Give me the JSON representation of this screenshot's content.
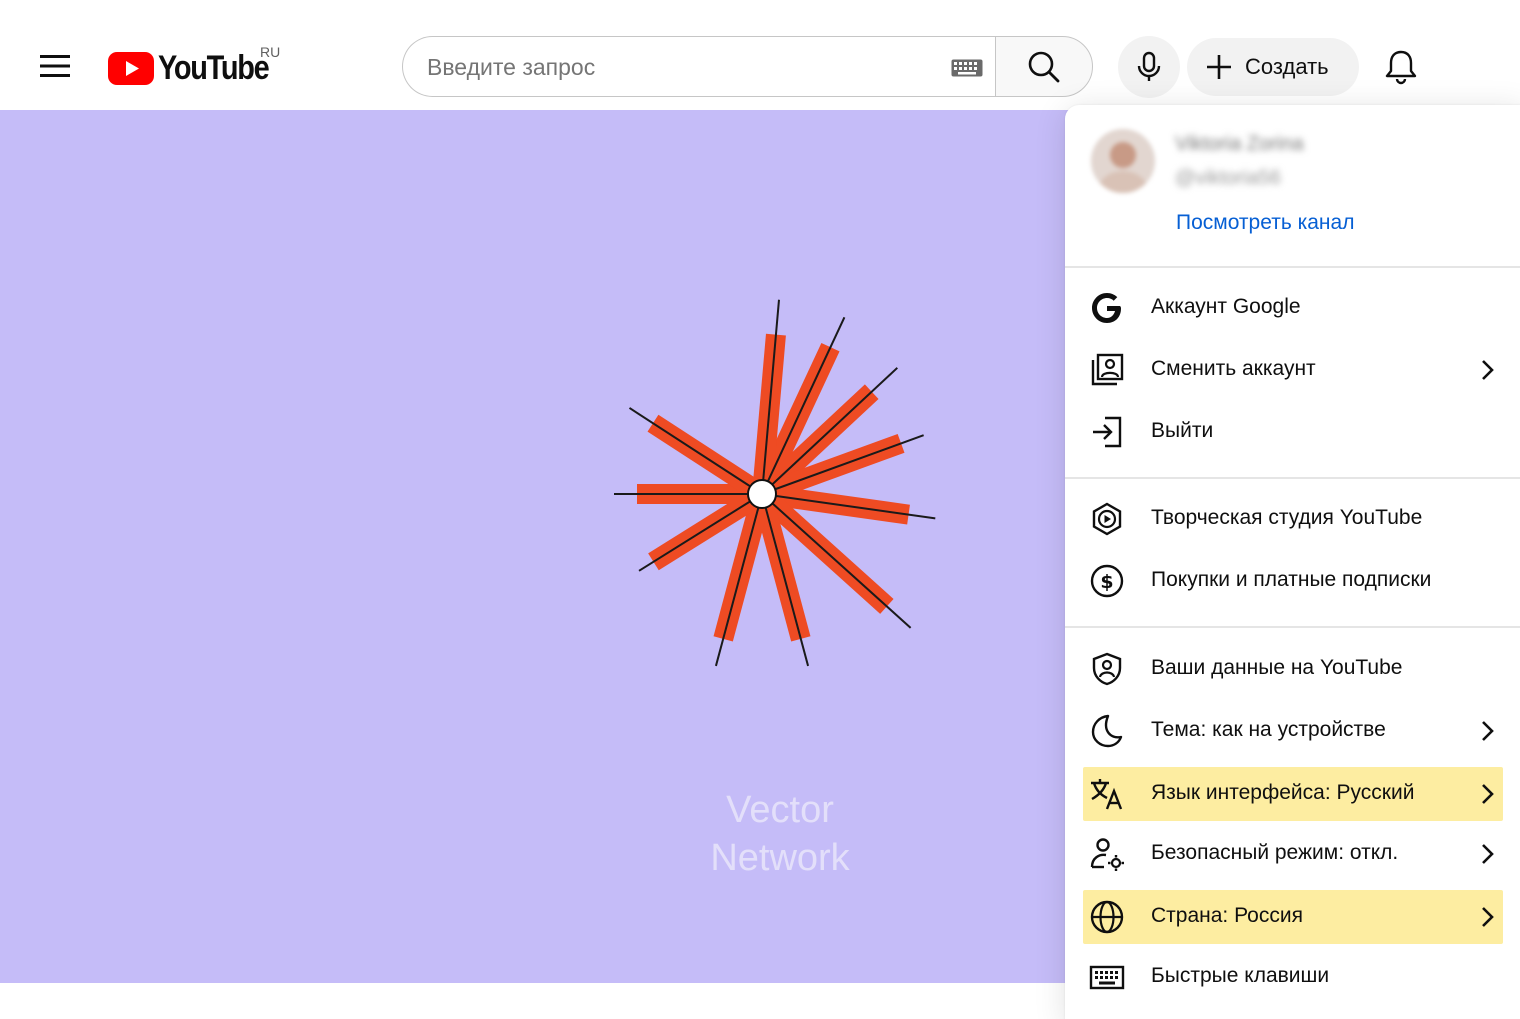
{
  "header": {
    "logo_text": "YouTube",
    "country_code": "RU",
    "search_placeholder": "Введите запрос",
    "create_label": "Создать"
  },
  "video": {
    "watermark_line1": "Vector",
    "watermark_line2": "Network",
    "background_color": "#c5bcf8",
    "accent_color": "#ee4b23"
  },
  "account": {
    "name": "Viktoria Zorina",
    "handle": "@viktoria56",
    "view_channel": "Посмотреть канал"
  },
  "menu": {
    "google_account": "Аккаунт Google",
    "switch_account": "Сменить аккаунт",
    "sign_out": "Выйти",
    "studio": "Творческая студия YouTube",
    "purchases": "Покупки и платные подписки",
    "your_data": "Ваши данные на YouTube",
    "theme": "Тема: как на устройстве",
    "language": "Язык интерфейса: Русский",
    "restricted_mode": "Безопасный режим: откл.",
    "location": "Страна: Россия",
    "shortcuts": "Быстрые клавиши"
  },
  "icons": {
    "menu": "hamburger-icon",
    "search": "search-icon",
    "keyboard": "keyboard-icon",
    "mic": "microphone-icon",
    "create": "plus-icon",
    "notifications": "bell-icon",
    "google": "google-g-icon",
    "switch": "switch-account-icon",
    "sign_out": "sign-out-icon",
    "studio": "youtube-studio-icon",
    "purchases": "dollar-icon",
    "your_data": "shield-person-icon",
    "theme": "moon-icon",
    "language": "translate-icon",
    "restricted": "person-settings-icon",
    "location": "globe-icon",
    "shortcuts": "keyboard-icon",
    "chevron": "chevron-right-icon"
  },
  "colors": {
    "youtube_red": "#ff0000",
    "link_blue": "#065fd4",
    "highlight": "#fdeda1"
  }
}
